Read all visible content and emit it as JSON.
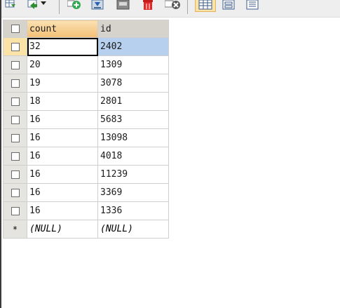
{
  "toolbar": {
    "buttons": [
      {
        "icon": "grid-export-icon"
      },
      {
        "icon": "import-dropdown-icon"
      },
      {
        "icon": "add-row-icon"
      },
      {
        "icon": "save-icon"
      },
      {
        "icon": "duplicate-icon"
      },
      {
        "icon": "delete-icon"
      },
      {
        "icon": "cancel-icon"
      },
      {
        "icon": "grid-view-icon"
      },
      {
        "icon": "form-view-icon"
      },
      {
        "icon": "text-view-icon"
      }
    ]
  },
  "grid": {
    "columns": [
      "count",
      "id"
    ],
    "rows": [
      {
        "count": "32",
        "id": "2402"
      },
      {
        "count": "20",
        "id": "1309"
      },
      {
        "count": "19",
        "id": "3078"
      },
      {
        "count": "18",
        "id": "2801"
      },
      {
        "count": "16",
        "id": "5683"
      },
      {
        "count": "16",
        "id": "13098"
      },
      {
        "count": "16",
        "id": "4018"
      },
      {
        "count": "16",
        "id": "11239"
      },
      {
        "count": "16",
        "id": "3369"
      },
      {
        "count": "16",
        "id": "1336"
      }
    ],
    "new_row": {
      "marker": "*",
      "count": "(NULL)",
      "id": "(NULL)"
    }
  },
  "colors": {
    "selected_cell": "#b6d0ee",
    "sorted_header": "#f2bf76",
    "header": "#d5d3cc"
  }
}
